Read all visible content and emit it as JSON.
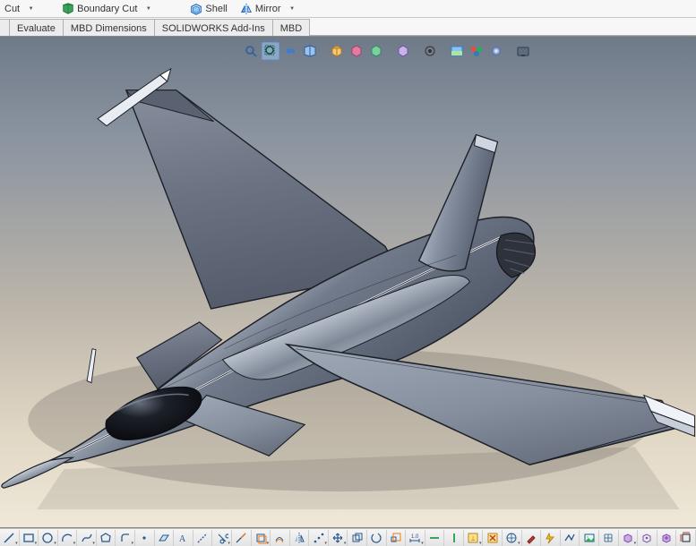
{
  "ribbon": {
    "cut_label": "Cut",
    "boundary_cut_label": "Boundary Cut",
    "shell_label": "Shell",
    "mirror_label": "Mirror"
  },
  "tabs": {
    "items": [
      {
        "label": "Evaluate"
      },
      {
        "label": "MBD Dimensions"
      },
      {
        "label": "SOLIDWORKS Add-Ins"
      },
      {
        "label": "MBD"
      }
    ]
  },
  "hud": {
    "icons": [
      "zoom-to-fit",
      "zoom-area",
      "prev-view",
      "section-view",
      "view-orientation",
      "display-style",
      "hide-show",
      "",
      "edit-appearance",
      "",
      "view-palette",
      "apply-scene",
      "view-settings",
      "render-tools",
      "",
      "screen-capture"
    ],
    "selected_index": 1
  },
  "viewport": {
    "model_name": "fighter-jet-3d-model"
  },
  "bottom_toolbar": {
    "icons": [
      "line",
      "corner-rect",
      "circle",
      "arc",
      "spline",
      "polygon",
      "fillet",
      "point",
      "plane",
      "text",
      "construction",
      "trim",
      "extend",
      "convert",
      "offset",
      "mirror",
      "pattern",
      "move",
      "copy",
      "rotate",
      "scale",
      "dimension",
      "horizontal",
      "vertical",
      "relations",
      "display-del",
      "quick-snaps",
      "repair",
      "rapid",
      "select-chain",
      "sketch-picture",
      "grid",
      "block",
      "make-block",
      "add-geom",
      "smart-dim",
      "auto-dim",
      "fully-define",
      "measure-a",
      "measure-b",
      "pierce",
      "tangent-arc"
    ]
  },
  "colors": {
    "steel_light": "#e8edf3",
    "steel_mid": "#a9b3c2",
    "steel_dark": "#4a5260",
    "edge": "#1b1f26",
    "shadow": "rgba(30,30,30,0.28)"
  }
}
